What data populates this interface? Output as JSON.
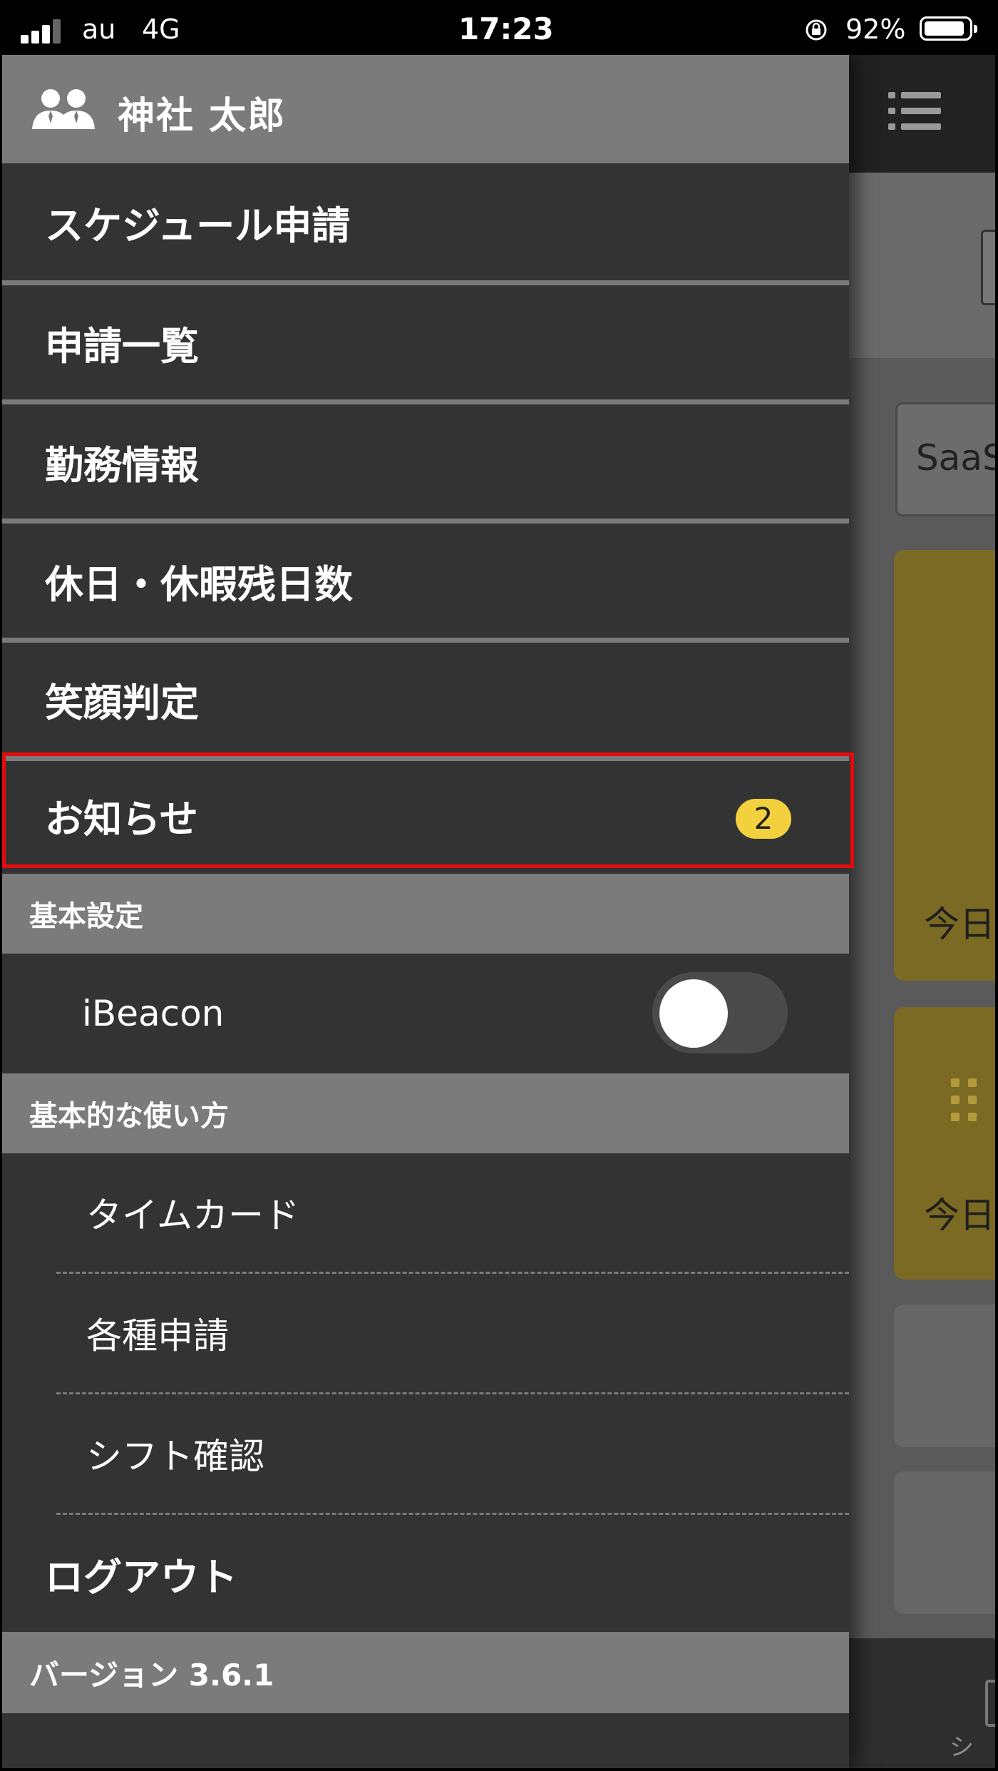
{
  "status_bar": {
    "carrier": "au",
    "network": "4G",
    "time": "17:23",
    "battery_percent": "92%",
    "battery_level": 0.92,
    "signal_bars_active": 3
  },
  "profile": {
    "name": "神社 太郎",
    "icon": "users-icon"
  },
  "menu": {
    "items": [
      {
        "label": "スケジュール申請"
      },
      {
        "label": "申請一覧"
      },
      {
        "label": "勤務情報"
      },
      {
        "label": "休日・休暇残日数"
      },
      {
        "label": "笑顔判定"
      },
      {
        "label": "お知らせ",
        "badge": "2"
      }
    ]
  },
  "basic_settings": {
    "header": "基本設定",
    "ibeacon_label": "iBeacon",
    "ibeacon_enabled": false
  },
  "how_to_use": {
    "header": "基本的な使い方",
    "items": [
      {
        "label": "タイムカード"
      },
      {
        "label": "各種申請"
      },
      {
        "label": "シフト確認"
      }
    ]
  },
  "logout_label": "ログアウト",
  "version_label": "バージョン 3.6.1",
  "background_app": {
    "input_text": "SaaS",
    "card1_text": "今日",
    "card2_text": "今日",
    "tab_label": "シフ"
  },
  "colors": {
    "highlight": "#e40b0b",
    "badge": "#f3d03e",
    "drawer_bg": "#333333",
    "section_bg": "#7b7b7b"
  }
}
